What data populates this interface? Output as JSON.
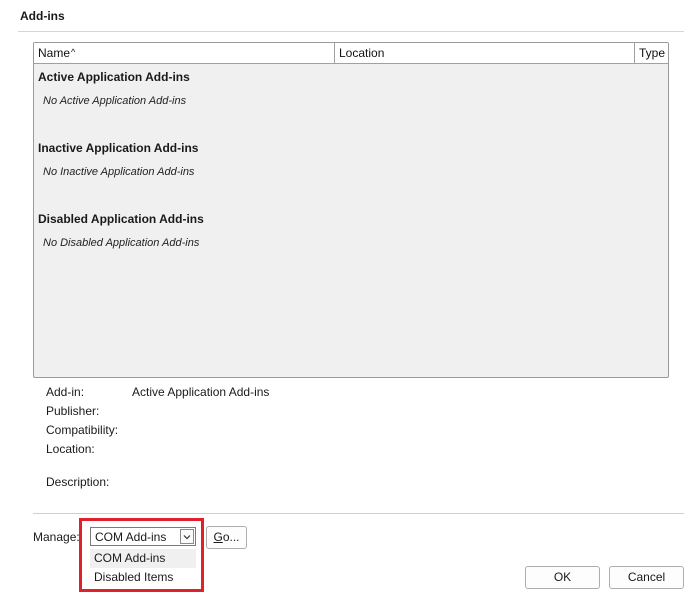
{
  "section": {
    "title": "Add-ins"
  },
  "listview": {
    "columns": {
      "name": "Name",
      "name_sort_glyph": "^",
      "location": "Location",
      "type": "Type"
    },
    "groups": [
      {
        "title": "Active Application Add-ins",
        "empty": "No Active Application Add-ins"
      },
      {
        "title": "Inactive Application Add-ins",
        "empty": "No Inactive Application Add-ins"
      },
      {
        "title": "Disabled Application Add-ins",
        "empty": "No Disabled Application Add-ins"
      }
    ]
  },
  "details": {
    "addin_label": "Add-in:",
    "addin_value": "Active Application Add-ins",
    "publisher_label": "Publisher:",
    "compatibility_label": "Compatibility:",
    "location_label": "Location:",
    "description_label": "Description:"
  },
  "manage": {
    "label": "Manage:",
    "selected": "COM Add-ins",
    "options": [
      "COM Add-ins",
      "Disabled Items"
    ],
    "go_label_underlined": "G",
    "go_label_rest": "o..."
  },
  "buttons": {
    "ok": "OK",
    "cancel": "Cancel"
  },
  "colors": {
    "highlight": "#e0202a",
    "list_bg": "#f0f0f0"
  },
  "icons": {
    "combo_arrow": "chevron-down-icon",
    "sort": "sort-ascending-icon"
  }
}
